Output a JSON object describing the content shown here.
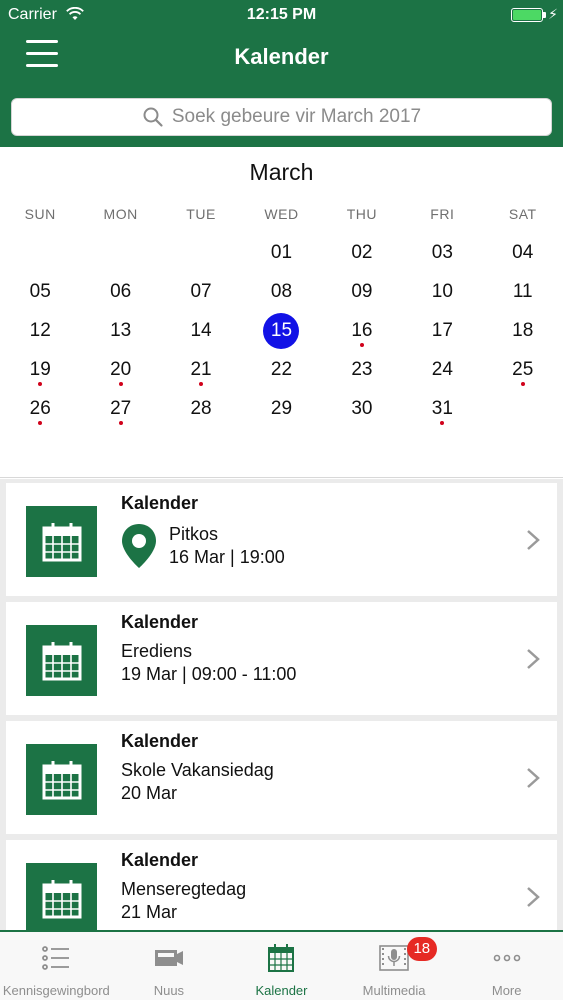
{
  "status_bar": {
    "carrier": "Carrier",
    "time": "12:15 PM"
  },
  "nav": {
    "title": "Kalender",
    "menu_icon": "hamburger-menu-icon"
  },
  "search": {
    "placeholder": "Soek gebeure vir March 2017"
  },
  "calendar": {
    "month": "March",
    "weekdays": [
      "SUN",
      "MON",
      "TUE",
      "WED",
      "THU",
      "FRI",
      "SAT"
    ],
    "leading_blank_days": 3,
    "days": [
      "01",
      "02",
      "03",
      "04",
      "05",
      "06",
      "07",
      "08",
      "09",
      "10",
      "11",
      "12",
      "13",
      "14",
      "15",
      "16",
      "17",
      "18",
      "19",
      "20",
      "21",
      "22",
      "23",
      "24",
      "25",
      "26",
      "27",
      "28",
      "29",
      "30",
      "31"
    ],
    "selected_day": "15",
    "event_dot_days": [
      "16",
      "19",
      "20",
      "21",
      "25",
      "26",
      "27",
      "31"
    ],
    "colors": {
      "selected": "#1212e6",
      "event_dot": "#d0021b"
    }
  },
  "events": [
    {
      "category": "Kalender",
      "title": "Pitkos",
      "when": "16 Mar | 19:00",
      "has_location_pin": true
    },
    {
      "category": "Kalender",
      "title": "Erediens",
      "when": "19 Mar | 09:00 - 11:00",
      "has_location_pin": false
    },
    {
      "category": "Kalender",
      "title": "Skole Vakansiedag",
      "when": "20 Mar",
      "has_location_pin": false
    },
    {
      "category": "Kalender",
      "title": "Menseregtedag",
      "when": "21 Mar",
      "has_location_pin": false
    }
  ],
  "tab_bar": {
    "active": "Kalender",
    "tabs": [
      {
        "label": "Kennisgewingbord",
        "icon": "list-icon"
      },
      {
        "label": "Nuus",
        "icon": "news-camera-icon"
      },
      {
        "label": "Kalender",
        "icon": "calendar-icon"
      },
      {
        "label": "Multimedia",
        "icon": "microphone-film-icon",
        "badge": "18"
      },
      {
        "label": "More",
        "icon": "more-dots-icon"
      }
    ]
  },
  "colors": {
    "brand_green": "#1c7345",
    "badge_red": "#e62a24"
  }
}
